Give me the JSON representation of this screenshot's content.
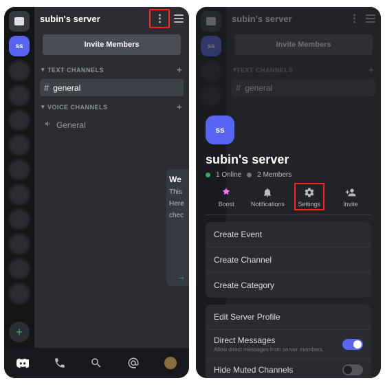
{
  "left": {
    "server_initials": "ss",
    "server_name": "subin's server",
    "invite": "Invite Members",
    "cat_text": "TEXT CHANNELS",
    "cat_voice": "VOICE CHANNELS",
    "chan_general": "general",
    "chan_voice_general": "General",
    "peek_welcome": "We",
    "peek_line1": "This",
    "peek_line2": "Here",
    "peek_line3": "chec"
  },
  "right": {
    "server_initials": "ss",
    "server_name": "subin's server",
    "online": "1 Online",
    "members": "2 Members",
    "actions": {
      "boost": "Boost",
      "notifications": "Notifications",
      "settings": "Settings",
      "invite": "Invite"
    },
    "menu": {
      "create_event": "Create Event",
      "create_channel": "Create Channel",
      "create_category": "Create Category"
    },
    "edit_profile": "Edit Server Profile",
    "dm_title": "Direct Messages",
    "dm_sub": "Allow direct messages from server members.",
    "hide_muted": "Hide Muted Channels"
  }
}
